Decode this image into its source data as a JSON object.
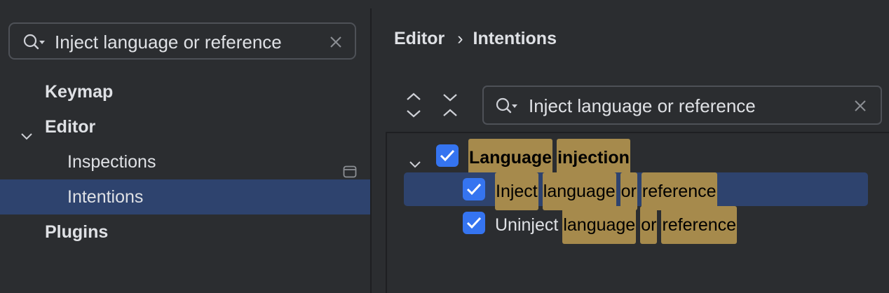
{
  "settings_search": {
    "value": "Inject language or reference"
  },
  "sidebar": {
    "items": [
      {
        "label": "Keymap"
      },
      {
        "label": "Editor"
      },
      {
        "label": "Inspections"
      },
      {
        "label": "Intentions"
      },
      {
        "label": "Plugins"
      }
    ]
  },
  "breadcrumb": {
    "parent": "Editor",
    "separator": "›",
    "current": "Intentions"
  },
  "filter": {
    "value": "Inject language or reference"
  },
  "intentions": {
    "group": {
      "words": [
        "Language",
        "injection"
      ],
      "checked": true
    },
    "items": [
      {
        "words": [
          "Inject",
          "language",
          "or",
          "reference"
        ],
        "checked": true
      },
      {
        "prefix": "Uninject",
        "words": [
          "language",
          "or",
          "reference"
        ],
        "checked": true
      }
    ]
  },
  "colors": {
    "background": "#2b2d30",
    "selection": "#2e436e",
    "checkbox": "#3574f0",
    "match_highlight": "#a68a4c"
  },
  "icons": {
    "search": "search-icon",
    "clear": "close-icon",
    "expand_all": "expand-all-icon",
    "collapse_all": "collapse-all-icon",
    "chevron": "chevron-down-icon",
    "settings_page": "settings-page-icon"
  }
}
